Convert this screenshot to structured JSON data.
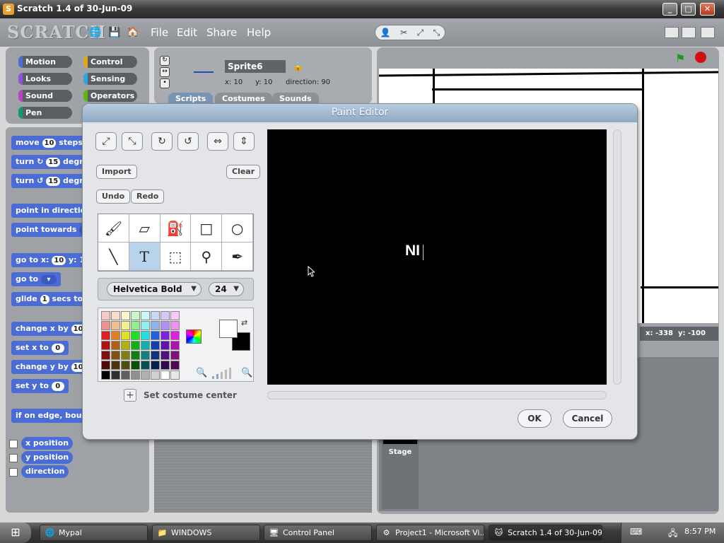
{
  "window": {
    "title": "Scratch 1.4 of 30-Jun-09",
    "app_icon": "scratch-cat-icon",
    "controls": [
      "minimize",
      "maximize",
      "close"
    ]
  },
  "menubar": {
    "logo": "SCRATCH",
    "menus": [
      "File",
      "Edit",
      "Share",
      "Help"
    ],
    "icons": [
      "globe-icon",
      "save-icon",
      "share-icon"
    ],
    "tools": [
      "duplicate-icon",
      "delete-icon",
      "grow-icon",
      "shrink-icon"
    ]
  },
  "categories": {
    "left": [
      "Motion",
      "Looks",
      "Sound",
      "Pen"
    ],
    "right": [
      "Control",
      "Sensing",
      "Operators"
    ],
    "colors": {
      "Motion": "#4a6cd4",
      "Looks": "#8a55d7",
      "Sound": "#bb42c3",
      "Pen": "#0e9a6c",
      "Control": "#e1a91a",
      "Sensing": "#2ca5e2",
      "Operators": "#5cb712"
    }
  },
  "blocks": [
    {
      "pre": "move",
      "slot": "10",
      "post": "steps"
    },
    {
      "pre": "turn ↻",
      "slot": "15",
      "post": "degr"
    },
    {
      "pre": "turn ↺",
      "slot": "15",
      "post": "degr"
    },
    {
      "pre": "point in direction",
      "slot": "",
      "post": ""
    },
    {
      "pre": "point towards",
      "slot": "",
      "post": ""
    },
    {
      "pre": "go to x:",
      "slot": "10",
      "post": "y: 1"
    },
    {
      "pre": "go to",
      "slot": "▾",
      "post": ""
    },
    {
      "pre": "glide",
      "slot": "1",
      "post": "secs to"
    },
    {
      "pre": "change x by",
      "slot": "10",
      "post": ""
    },
    {
      "pre": "set x to",
      "slot": "0",
      "post": ""
    },
    {
      "pre": "change y by",
      "slot": "10",
      "post": ""
    },
    {
      "pre": "set y to",
      "slot": "0",
      "post": ""
    },
    {
      "pre": "if on edge, bounce",
      "slot": "",
      "post": ""
    }
  ],
  "reporters": [
    "x position",
    "y position",
    "direction"
  ],
  "sprite": {
    "name": "Sprite6",
    "x_label": "x:",
    "x": "10",
    "y_label": "y:",
    "y": "10",
    "direction_label": "direction:",
    "direction": "90"
  },
  "tabs": [
    "Scripts",
    "Costumes",
    "Sounds"
  ],
  "stage": {
    "coords_x_label": "x:",
    "coords_x": "-338",
    "coords_y_label": "y:",
    "coords_y": "-100",
    "thumb_label": "Stage"
  },
  "paint_editor": {
    "title": "Paint Editor",
    "transform_icons": [
      "grow-icon",
      "shrink-icon",
      "rotate-cw-icon",
      "rotate-ccw-icon",
      "flip-horizontal-icon",
      "flip-vertical-icon"
    ],
    "import_label": "Import",
    "clear_label": "Clear",
    "undo_label": "Undo",
    "redo_label": "Redo",
    "tools": [
      "paintbrush-icon",
      "eraser-icon",
      "fill-icon",
      "rectangle-icon",
      "ellipse-icon",
      "line-icon",
      "text-icon",
      "select-icon",
      "stamp-icon",
      "eyedropper-icon"
    ],
    "active_tool": "text-icon",
    "font_name": "Helvetica Bold",
    "font_size": "24",
    "canvas_text": "NI",
    "set_center_label": "Set costume center",
    "ok_label": "OK",
    "cancel_label": "Cancel",
    "foreground_color": "#ffffff",
    "background_color": "#000000"
  },
  "taskbar": {
    "tasks": [
      {
        "label": "Mypal",
        "icon": "globe-icon"
      },
      {
        "label": "WINDOWS",
        "icon": "folder-icon"
      },
      {
        "label": "Control Panel",
        "icon": "control-panel-icon"
      },
      {
        "label": "Project1 - Microsoft Vi...",
        "icon": "visual-basic-icon"
      },
      {
        "label": "Scratch 1.4 of 30-Jun-09",
        "icon": "scratch-cat-icon"
      }
    ],
    "clock": "8:57 PM"
  }
}
